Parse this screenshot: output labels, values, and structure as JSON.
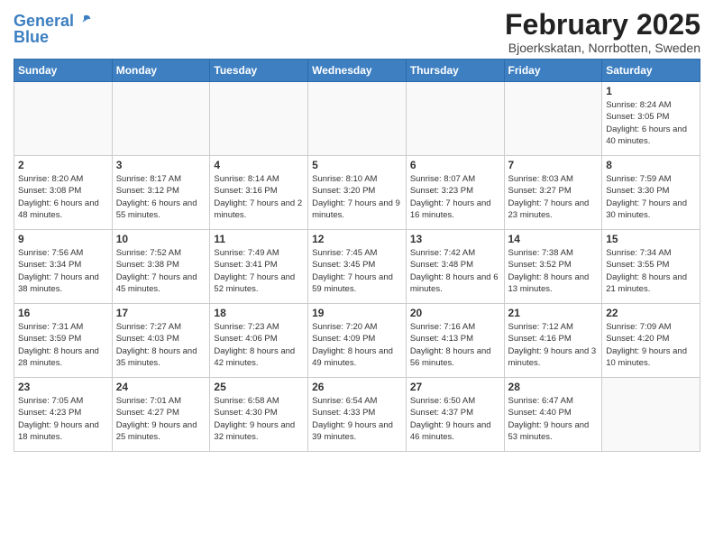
{
  "header": {
    "logo_general": "General",
    "logo_blue": "Blue",
    "month_title": "February 2025",
    "location": "Bjoerkskatan, Norrbotten, Sweden"
  },
  "weekdays": [
    "Sunday",
    "Monday",
    "Tuesday",
    "Wednesday",
    "Thursday",
    "Friday",
    "Saturday"
  ],
  "weeks": [
    [
      {
        "day": "",
        "info": ""
      },
      {
        "day": "",
        "info": ""
      },
      {
        "day": "",
        "info": ""
      },
      {
        "day": "",
        "info": ""
      },
      {
        "day": "",
        "info": ""
      },
      {
        "day": "",
        "info": ""
      },
      {
        "day": "1",
        "info": "Sunrise: 8:24 AM\nSunset: 3:05 PM\nDaylight: 6 hours and 40 minutes."
      }
    ],
    [
      {
        "day": "2",
        "info": "Sunrise: 8:20 AM\nSunset: 3:08 PM\nDaylight: 6 hours and 48 minutes."
      },
      {
        "day": "3",
        "info": "Sunrise: 8:17 AM\nSunset: 3:12 PM\nDaylight: 6 hours and 55 minutes."
      },
      {
        "day": "4",
        "info": "Sunrise: 8:14 AM\nSunset: 3:16 PM\nDaylight: 7 hours and 2 minutes."
      },
      {
        "day": "5",
        "info": "Sunrise: 8:10 AM\nSunset: 3:20 PM\nDaylight: 7 hours and 9 minutes."
      },
      {
        "day": "6",
        "info": "Sunrise: 8:07 AM\nSunset: 3:23 PM\nDaylight: 7 hours and 16 minutes."
      },
      {
        "day": "7",
        "info": "Sunrise: 8:03 AM\nSunset: 3:27 PM\nDaylight: 7 hours and 23 minutes."
      },
      {
        "day": "8",
        "info": "Sunrise: 7:59 AM\nSunset: 3:30 PM\nDaylight: 7 hours and 30 minutes."
      }
    ],
    [
      {
        "day": "9",
        "info": "Sunrise: 7:56 AM\nSunset: 3:34 PM\nDaylight: 7 hours and 38 minutes."
      },
      {
        "day": "10",
        "info": "Sunrise: 7:52 AM\nSunset: 3:38 PM\nDaylight: 7 hours and 45 minutes."
      },
      {
        "day": "11",
        "info": "Sunrise: 7:49 AM\nSunset: 3:41 PM\nDaylight: 7 hours and 52 minutes."
      },
      {
        "day": "12",
        "info": "Sunrise: 7:45 AM\nSunset: 3:45 PM\nDaylight: 7 hours and 59 minutes."
      },
      {
        "day": "13",
        "info": "Sunrise: 7:42 AM\nSunset: 3:48 PM\nDaylight: 8 hours and 6 minutes."
      },
      {
        "day": "14",
        "info": "Sunrise: 7:38 AM\nSunset: 3:52 PM\nDaylight: 8 hours and 13 minutes."
      },
      {
        "day": "15",
        "info": "Sunrise: 7:34 AM\nSunset: 3:55 PM\nDaylight: 8 hours and 21 minutes."
      }
    ],
    [
      {
        "day": "16",
        "info": "Sunrise: 7:31 AM\nSunset: 3:59 PM\nDaylight: 8 hours and 28 minutes."
      },
      {
        "day": "17",
        "info": "Sunrise: 7:27 AM\nSunset: 4:03 PM\nDaylight: 8 hours and 35 minutes."
      },
      {
        "day": "18",
        "info": "Sunrise: 7:23 AM\nSunset: 4:06 PM\nDaylight: 8 hours and 42 minutes."
      },
      {
        "day": "19",
        "info": "Sunrise: 7:20 AM\nSunset: 4:09 PM\nDaylight: 8 hours and 49 minutes."
      },
      {
        "day": "20",
        "info": "Sunrise: 7:16 AM\nSunset: 4:13 PM\nDaylight: 8 hours and 56 minutes."
      },
      {
        "day": "21",
        "info": "Sunrise: 7:12 AM\nSunset: 4:16 PM\nDaylight: 9 hours and 3 minutes."
      },
      {
        "day": "22",
        "info": "Sunrise: 7:09 AM\nSunset: 4:20 PM\nDaylight: 9 hours and 10 minutes."
      }
    ],
    [
      {
        "day": "23",
        "info": "Sunrise: 7:05 AM\nSunset: 4:23 PM\nDaylight: 9 hours and 18 minutes."
      },
      {
        "day": "24",
        "info": "Sunrise: 7:01 AM\nSunset: 4:27 PM\nDaylight: 9 hours and 25 minutes."
      },
      {
        "day": "25",
        "info": "Sunrise: 6:58 AM\nSunset: 4:30 PM\nDaylight: 9 hours and 32 minutes."
      },
      {
        "day": "26",
        "info": "Sunrise: 6:54 AM\nSunset: 4:33 PM\nDaylight: 9 hours and 39 minutes."
      },
      {
        "day": "27",
        "info": "Sunrise: 6:50 AM\nSunset: 4:37 PM\nDaylight: 9 hours and 46 minutes."
      },
      {
        "day": "28",
        "info": "Sunrise: 6:47 AM\nSunset: 4:40 PM\nDaylight: 9 hours and 53 minutes."
      },
      {
        "day": "",
        "info": ""
      }
    ]
  ]
}
